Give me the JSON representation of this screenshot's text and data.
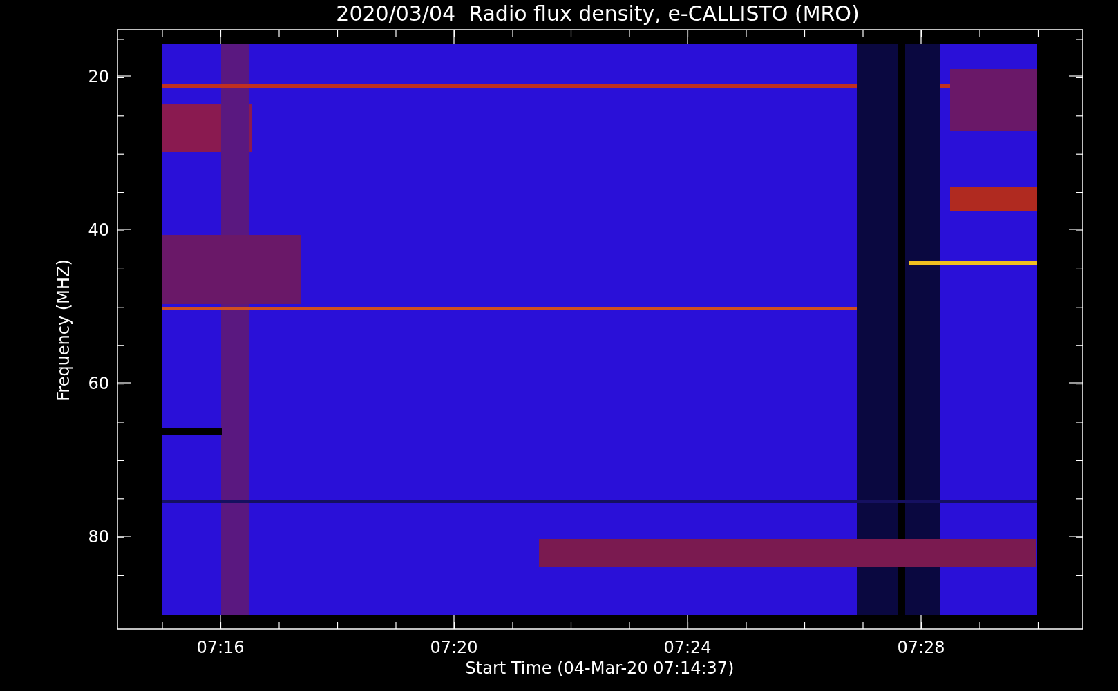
{
  "title": "2020/03/04  Radio flux density, e-CALLISTO (MRO)",
  "y_axis": {
    "label": "Frequency (MHZ)",
    "ticks": [
      "20",
      "40",
      "60",
      "80"
    ]
  },
  "x_axis": {
    "label": "Start Time (04-Mar-20 07:14:37)",
    "ticks": [
      "07:16",
      "07:20",
      "07:24",
      "07:28"
    ]
  }
}
